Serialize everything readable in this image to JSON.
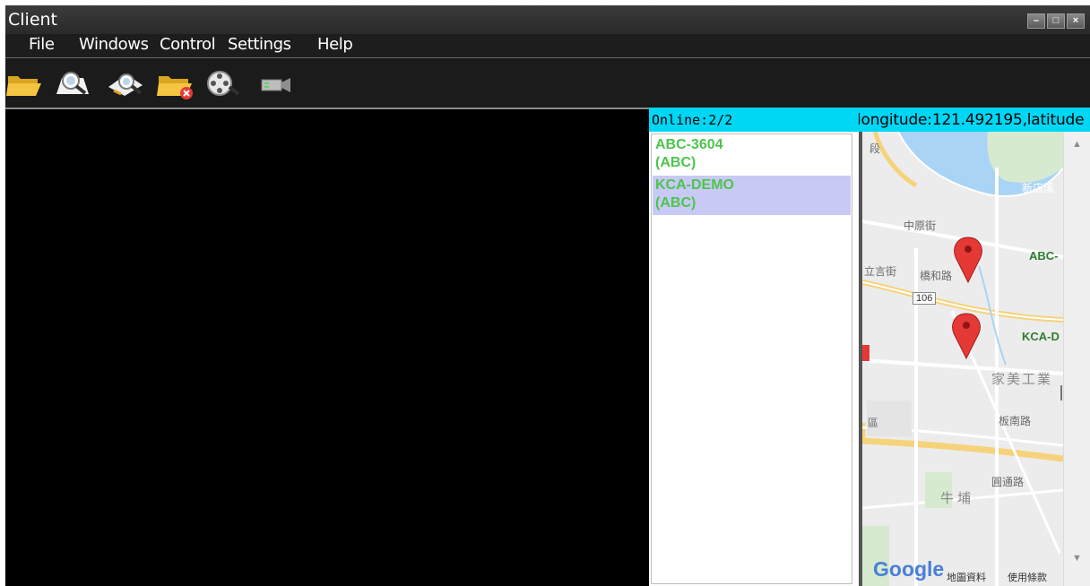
{
  "window": {
    "title": "Client"
  },
  "menu": [
    "File",
    "Windows",
    "Control",
    "Settings",
    "Help"
  ],
  "toolbar": [
    {
      "icon": "open-folder-icon"
    },
    {
      "icon": "search-icon"
    },
    {
      "icon": "search-edit-icon"
    },
    {
      "icon": "folder-delete-icon"
    },
    {
      "icon": "film-reel-search-icon"
    },
    {
      "icon": "camera-icon"
    }
  ],
  "devices": {
    "online": "Online:2/2",
    "items": [
      {
        "name": "ABC-3604",
        "group": "(ABC)",
        "selected": false
      },
      {
        "name": "KCA-DEMO",
        "group": "(ABC)",
        "selected": true
      }
    ]
  },
  "map": {
    "coords": "longitude:121.492195,latitude",
    "labels": {
      "l1": "ABC-",
      "l2": "KCA-D",
      "l3": "家美工業",
      "l4": "牛埔",
      "l5": "中原街",
      "l6": "橋和路",
      "l7": "立言街",
      "l8": "106",
      "l9": "新店溪",
      "l10": "區",
      "l11": "板南路",
      "l12": "圓通路",
      "l13": "段"
    },
    "attribution": {
      "google": "Google",
      "data": "地圖資料",
      "terms": "使用條款"
    }
  }
}
